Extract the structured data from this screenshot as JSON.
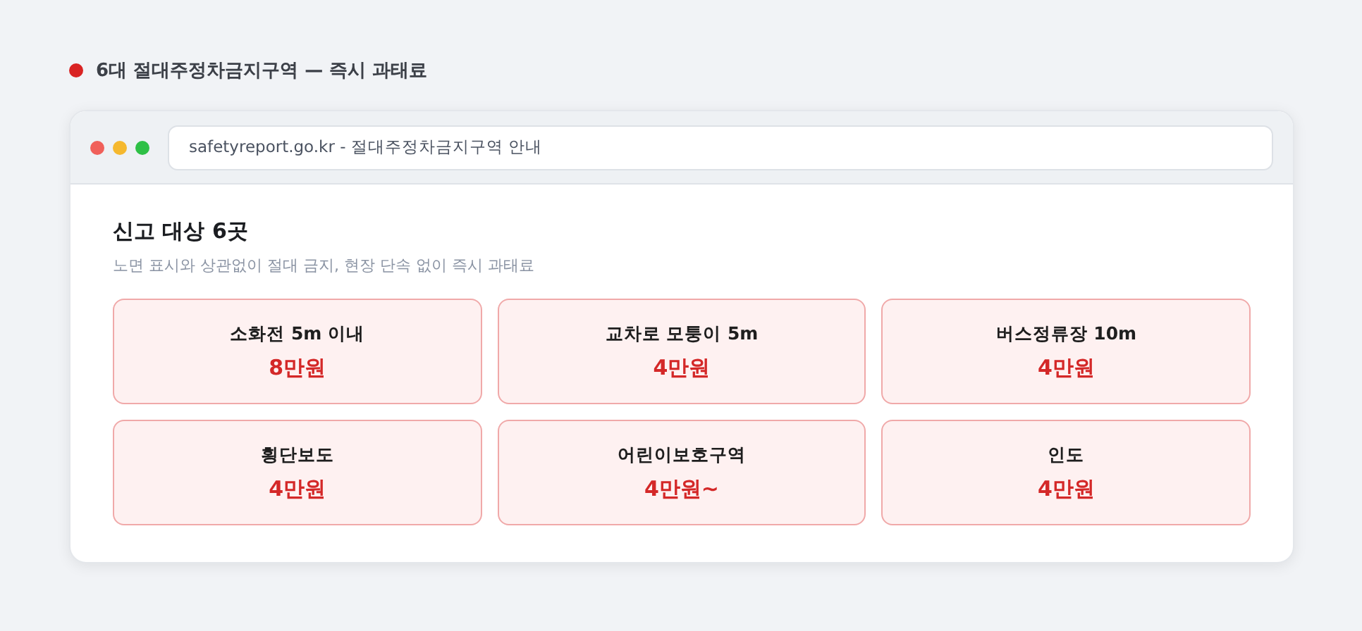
{
  "header": {
    "title": "6대 절대주정차금지구역 — 즉시 과태료"
  },
  "browser": {
    "address": "safetyreport.go.kr - 절대주정차금지구역 안내"
  },
  "content": {
    "title": "신고 대상 6곳",
    "subtitle": "노면 표시와 상관없이 절대 금지, 현장 단속 없이 즉시 과태료",
    "zones": [
      {
        "name": "소화전 5m 이내",
        "fine": "8만원"
      },
      {
        "name": "교차로 모퉁이 5m",
        "fine": "4만원"
      },
      {
        "name": "버스정류장 10m",
        "fine": "4만원"
      },
      {
        "name": "횡단보도",
        "fine": "4만원"
      },
      {
        "name": "어린이보호구역",
        "fine": "4만원~"
      },
      {
        "name": "인도",
        "fine": "4만원"
      }
    ]
  }
}
